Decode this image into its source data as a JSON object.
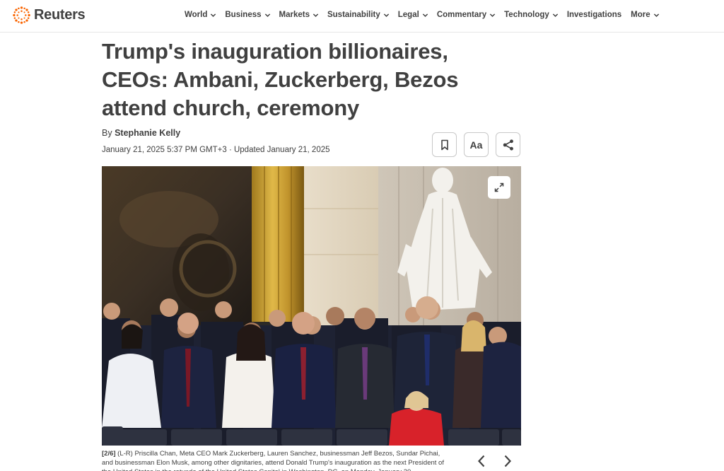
{
  "brand": {
    "name": "Reuters",
    "accent": "#fa6400"
  },
  "nav": {
    "items": [
      {
        "label": "World",
        "dropdown": true
      },
      {
        "label": "Business",
        "dropdown": true
      },
      {
        "label": "Markets",
        "dropdown": true
      },
      {
        "label": "Sustainability",
        "dropdown": true
      },
      {
        "label": "Legal",
        "dropdown": true
      },
      {
        "label": "Commentary",
        "dropdown": true
      },
      {
        "label": "Technology",
        "dropdown": true
      },
      {
        "label": "Investigations",
        "dropdown": false
      },
      {
        "label": "More",
        "dropdown": true
      }
    ]
  },
  "article": {
    "headline": "Trump's inauguration billionaires, CEOs: Ambani, Zuckerberg, Bezos attend church, ceremony",
    "byline_prefix": "By",
    "author": "Stephanie Kelly",
    "dateline": "January 21, 2025 5:37 PM GMT+3 · Updated January 21, 2025"
  },
  "tools": {
    "bookmark_icon": "bookmark-icon",
    "textsize_label": "Aa",
    "share_icon": "share-icon"
  },
  "photo": {
    "expand_icon": "expand-icon",
    "caption_count": "[2/6]",
    "caption_text": " (L-R) Priscilla Chan, Meta CEO Mark Zuckerberg, Lauren Sanchez, businessman Jeff Bezos, Sundar Pichai, and businessman Elon Musk, among other dignitaries, attend Donald Trump's inauguration as the next President of the United States in the rotunda of the United States Capitol in Washington, DC, on Monday, January 20..."
  },
  "carousel": {
    "prev_icon": "chevron-left-icon",
    "next_icon": "chevron-right-icon"
  }
}
